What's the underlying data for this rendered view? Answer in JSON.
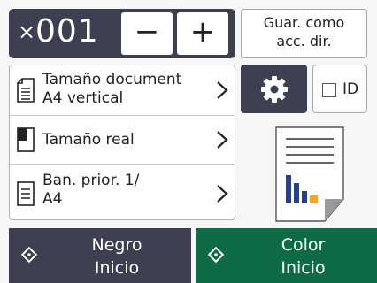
{
  "copies": {
    "prefix": "×",
    "value": "001",
    "minus_label": "−",
    "plus_label": "+"
  },
  "shortcut": {
    "line1": "Guar. como",
    "line2": "acc. dir."
  },
  "settings_list": {
    "items": [
      {
        "icon": "document-size-icon",
        "line1": "Tamaño document",
        "line2": "A4 vertical"
      },
      {
        "icon": "actual-size-icon",
        "line1": "Tamaño real",
        "line2": ""
      },
      {
        "icon": "tray-priority-icon",
        "line1": "Ban. prior. 1/",
        "line2": "A4"
      }
    ]
  },
  "id_button": {
    "label": "ID",
    "checked": false
  },
  "preview": {
    "icon": "document-preview-icon"
  },
  "start": {
    "mono": {
      "line1": "Negro",
      "line2": "Inicio"
    },
    "color": {
      "line1": "Color",
      "line2": "Inicio"
    }
  },
  "colors": {
    "dark": "#3e4052",
    "green": "#0e6b45",
    "preview_blue": "#2a3f8f",
    "preview_orange": "#f5a623"
  }
}
